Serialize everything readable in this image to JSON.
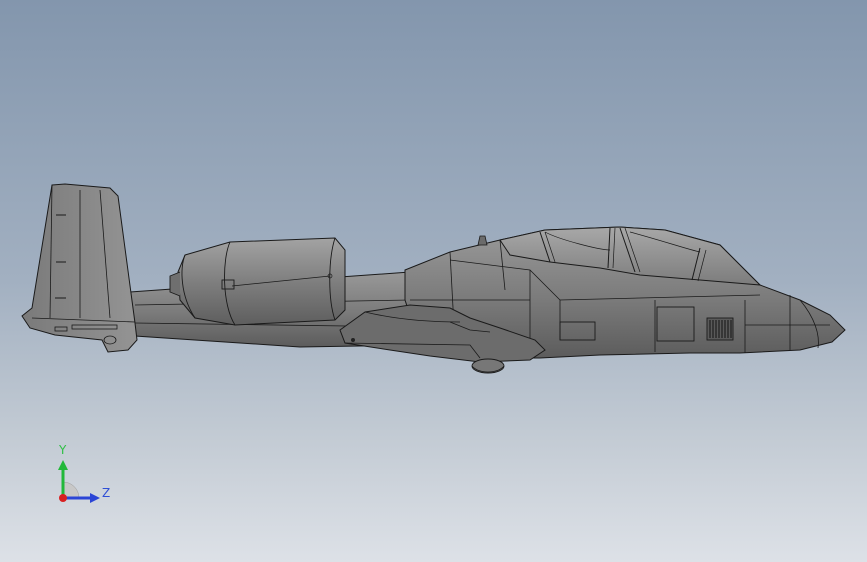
{
  "triad": {
    "y_label": "Y",
    "z_label": "Z",
    "colors": {
      "y_axis": "#22b83a",
      "z_axis": "#2b45d6",
      "x_axis": "#d82020"
    }
  },
  "model": {
    "shading": "#7d7d7d",
    "edge_color": "#1a1a1a"
  }
}
